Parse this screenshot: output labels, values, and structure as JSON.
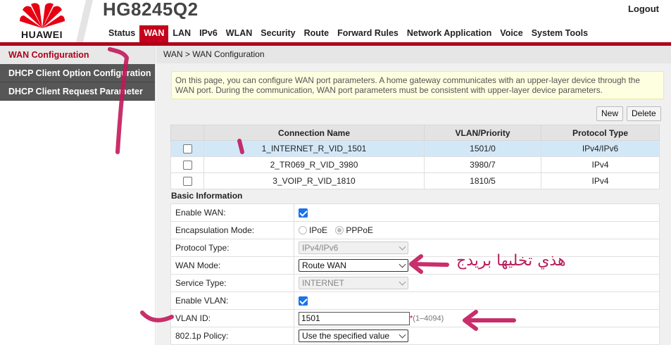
{
  "header": {
    "brand": "HUAWEI",
    "device_model": "HG8245Q2",
    "logout_label": "Logout",
    "brand_color": "#c4001c"
  },
  "nav": {
    "items": [
      "Status",
      "WAN",
      "LAN",
      "IPv6",
      "WLAN",
      "Security",
      "Route",
      "Forward Rules",
      "Network Application",
      "Voice",
      "System Tools"
    ],
    "active": "WAN"
  },
  "sidebar": {
    "items": [
      {
        "label": "WAN Configuration",
        "active": true
      },
      {
        "label": "DHCP Client Option Configuration",
        "active": false
      },
      {
        "label": "DHCP Client Request Parameter",
        "active": false
      }
    ]
  },
  "breadcrumb": "WAN > WAN Configuration",
  "info_text": "On this page, you can configure WAN port parameters. A home gateway communicates with an upper-layer device through the WAN port. During the communication, WAN port parameters must be consistent with upper-layer device parameters.",
  "buttons": {
    "new_label": "New",
    "delete_label": "Delete"
  },
  "connections": {
    "headers": [
      "Connection Name",
      "VLAN/Priority",
      "Protocol Type"
    ],
    "rows": [
      {
        "name": "1_INTERNET_R_VID_1501",
        "vlan_priority": "1501/0",
        "protocol": "IPv4/IPv6",
        "selected": true
      },
      {
        "name": "2_TR069_R_VID_3980",
        "vlan_priority": "3980/7",
        "protocol": "IPv4",
        "selected": false
      },
      {
        "name": "3_VOIP_R_VID_1810",
        "vlan_priority": "1810/5",
        "protocol": "IPv4",
        "selected": false
      }
    ]
  },
  "basic": {
    "title": "Basic Information",
    "enable_wan_label": "Enable WAN:",
    "enable_wan_checked": true,
    "encap_label": "Encapsulation Mode:",
    "encap_options": [
      "IPoE",
      "PPPoE"
    ],
    "encap_selected": "PPPoE",
    "protocol_label": "Protocol Type:",
    "protocol_value": "IPv4/IPv6",
    "wan_mode_label": "WAN Mode:",
    "wan_mode_value": "Route WAN",
    "service_label": "Service Type:",
    "service_value": "INTERNET",
    "enable_vlan_label": "Enable VLAN:",
    "enable_vlan_checked": true,
    "vlan_id_label": "VLAN ID:",
    "vlan_id_value": "1501",
    "vlan_hint_star": "*",
    "vlan_hint": "(1–4094)",
    "policy_label": "802.1p Policy:",
    "policy_value": "Use the specified value"
  },
  "annotation": {
    "arabic_text": "هذي تخليها بريدج",
    "color": "#b81c5a"
  }
}
